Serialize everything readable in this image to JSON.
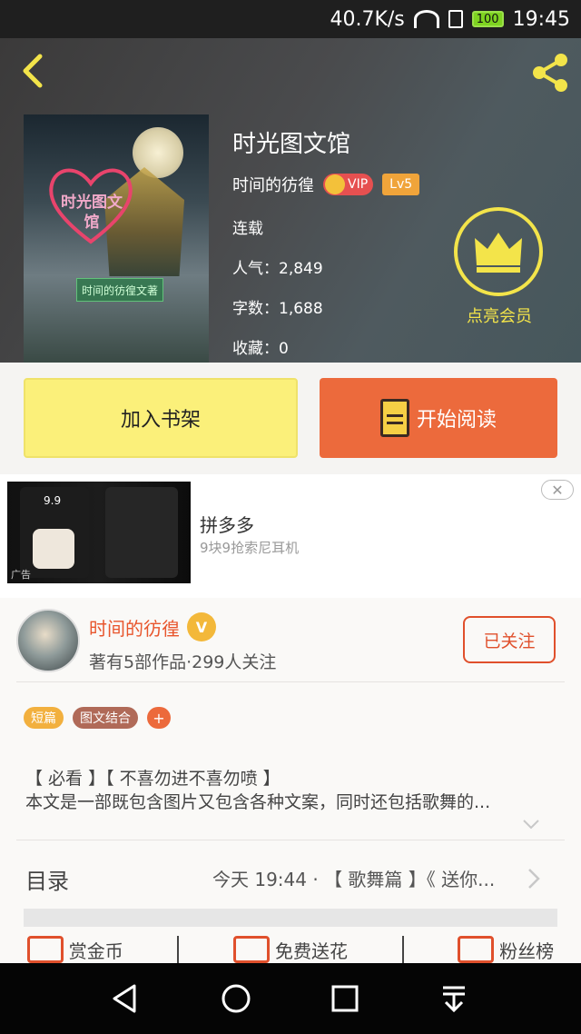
{
  "status_bar": {
    "speed": "40.7K/s",
    "battery": "100",
    "time": "19:45"
  },
  "book": {
    "title": "时光图文馆",
    "author": "时间的彷徨",
    "vip": "VIP",
    "level": "Lv5",
    "status": "连载",
    "popularity": "人气：2,849",
    "word_count": "字数：1,688",
    "favorites": "收藏：0",
    "cover_heart_text": "时光图文馆",
    "cover_tag": "时间的彷徨文著"
  },
  "member": {
    "label": "点亮会员"
  },
  "actions": {
    "add_shelf": "加入书架",
    "start_read": "开始阅读"
  },
  "ad": {
    "title": "拼多多",
    "subtitle": "9块9抢索尼耳机",
    "label": "广告",
    "price_text": "9.9"
  },
  "author_card": {
    "name": "时间的彷徨",
    "verified": "V",
    "summary": "著有5部作品·299人关注",
    "follow": "已关注"
  },
  "tags": {
    "short": "短篇",
    "mix": "图文结合",
    "add": "+"
  },
  "description": {
    "line1": "【 必看 】【 不喜勿进不喜勿喷 】",
    "line2": "本文是一部既包含图片又包含各种文案，同时还包括歌舞的..."
  },
  "toc": {
    "label": "目录",
    "latest": "今天 19:44 · 【 歌舞篇 】《 送你..."
  },
  "bottom_actions": [
    "赏金币",
    "免费送花",
    "粉丝榜"
  ],
  "colors": {
    "accent": "#ec6a3c",
    "yellow": "#fbf07a",
    "member": "#f3e44a"
  }
}
